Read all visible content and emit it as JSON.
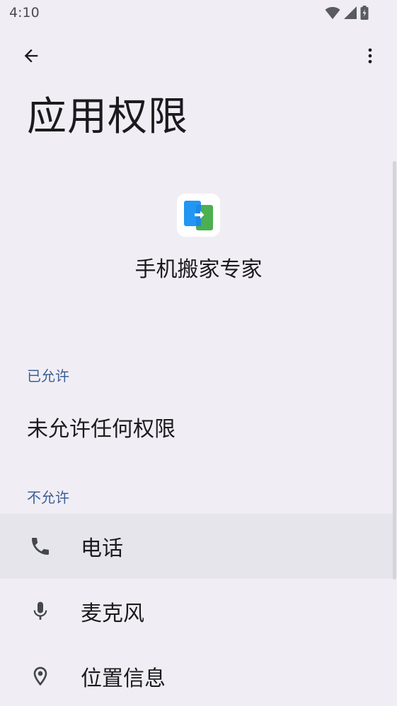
{
  "status_bar": {
    "time": "4:10",
    "icons": [
      "wifi-icon",
      "signal-icon",
      "battery-charging-icon"
    ]
  },
  "app_bar": {
    "back_icon": "arrow-left-icon",
    "overflow_icon": "more-vert-icon"
  },
  "page": {
    "title": "应用权限"
  },
  "app": {
    "name": "手机搬家专家",
    "icon_colors": {
      "blue": "#2196f3",
      "green": "#4caf50"
    }
  },
  "allowed": {
    "header": "已允许",
    "empty_text": "未允许任何权限"
  },
  "denied": {
    "header": "不允许",
    "items": [
      {
        "label": "电话",
        "icon": "phone-icon"
      },
      {
        "label": "麦克风",
        "icon": "microphone-icon"
      },
      {
        "label": "位置信息",
        "icon": "location-pin-icon"
      }
    ]
  },
  "colors": {
    "background": "#f0eef4",
    "section_header": "#3b5f94",
    "highlight_row": "#e7e5ec"
  }
}
